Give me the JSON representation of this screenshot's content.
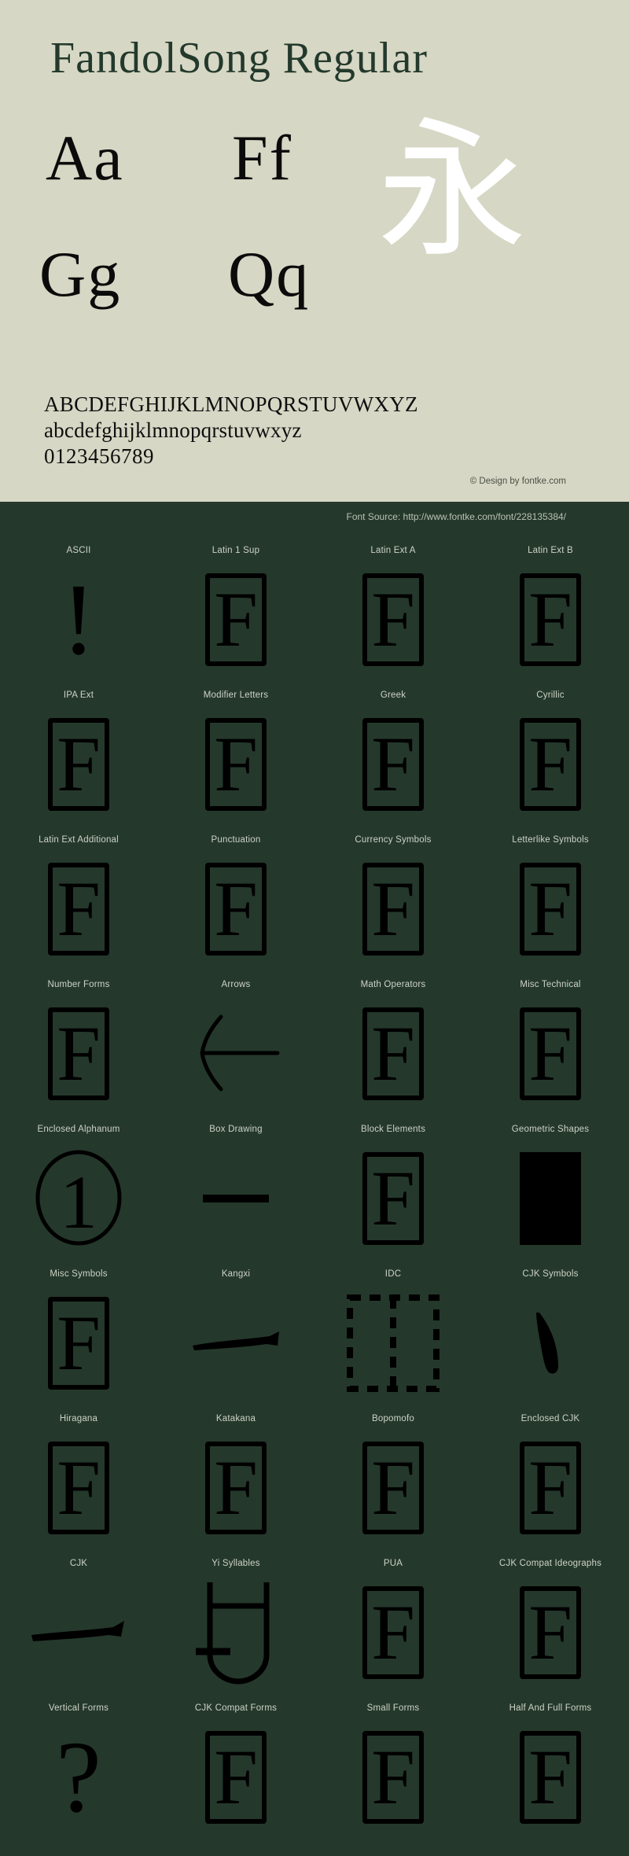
{
  "specimen": {
    "title": "FandolSong Regular",
    "glyph_pairs": [
      "Aa",
      "Ff",
      "Gg",
      "Qq"
    ],
    "cjk_sample": "永",
    "uppercase": "ABCDEFGHIJKLMNOPQRSTUVWXYZ",
    "lowercase": "abcdefghijklmnopqrstuvwxyz",
    "digits": "0123456789",
    "credit": "© Design by fontke.com",
    "bg_color": "#d6d7c4",
    "title_color": "#23392c",
    "cjk_color": "#ffffff"
  },
  "coverage": {
    "source": "Font Source: http://www.fontke.com/font/228135384/",
    "bg_color": "#25382c",
    "label_color": "#ccd3c6",
    "glyph_color": "#000000",
    "blocks": [
      {
        "label": "ASCII",
        "glyph": "!",
        "kind": "exclam"
      },
      {
        "label": "Latin 1 Sup",
        "glyph": "F",
        "kind": "tofu"
      },
      {
        "label": "Latin Ext A",
        "glyph": "F",
        "kind": "tofu"
      },
      {
        "label": "Latin Ext B",
        "glyph": "F",
        "kind": "tofu"
      },
      {
        "label": "IPA Ext",
        "glyph": "F",
        "kind": "tofu"
      },
      {
        "label": "Modifier Letters",
        "glyph": "F",
        "kind": "tofu"
      },
      {
        "label": "Greek",
        "glyph": "F",
        "kind": "tofu"
      },
      {
        "label": "Cyrillic",
        "glyph": "F",
        "kind": "tofu"
      },
      {
        "label": "Latin Ext Additional",
        "glyph": "F",
        "kind": "tofu"
      },
      {
        "label": "Punctuation",
        "glyph": "F",
        "kind": "tofu"
      },
      {
        "label": "Currency Symbols",
        "glyph": "F",
        "kind": "tofu"
      },
      {
        "label": "Letterlike Symbols",
        "glyph": "F",
        "kind": "tofu"
      },
      {
        "label": "Number Forms",
        "glyph": "F",
        "kind": "tofu"
      },
      {
        "label": "Arrows",
        "glyph": "←",
        "kind": "arrow-left"
      },
      {
        "label": "Math Operators",
        "glyph": "F",
        "kind": "tofu"
      },
      {
        "label": "Misc Technical",
        "glyph": "F",
        "kind": "tofu"
      },
      {
        "label": "Enclosed Alphanum",
        "glyph": "①",
        "kind": "circled-one"
      },
      {
        "label": "Box Drawing",
        "glyph": "─",
        "kind": "dash"
      },
      {
        "label": "Block Elements",
        "glyph": "F",
        "kind": "tofu"
      },
      {
        "label": "Geometric Shapes",
        "glyph": "■",
        "kind": "filled-block"
      },
      {
        "label": "Misc Symbols",
        "glyph": "F",
        "kind": "tofu"
      },
      {
        "label": "Kangxi",
        "glyph": "一",
        "kind": "stroke-right"
      },
      {
        "label": "IDC",
        "glyph": "⿰",
        "kind": "idc-dashed"
      },
      {
        "label": "CJK Symbols",
        "glyph": "、",
        "kind": "comma-stroke"
      },
      {
        "label": "Hiragana",
        "glyph": "F",
        "kind": "tofu"
      },
      {
        "label": "Katakana",
        "glyph": "F",
        "kind": "tofu"
      },
      {
        "label": "Bopomofo",
        "glyph": "F",
        "kind": "tofu"
      },
      {
        "label": "Enclosed CJK",
        "glyph": "F",
        "kind": "tofu"
      },
      {
        "label": "CJK",
        "glyph": "一",
        "kind": "stroke-right2"
      },
      {
        "label": "Yi Syllables",
        "glyph": "ꀀ",
        "kind": "yi-shape"
      },
      {
        "label": "PUA",
        "glyph": "F",
        "kind": "tofu"
      },
      {
        "label": "CJK Compat Ideographs",
        "glyph": "F",
        "kind": "tofu"
      },
      {
        "label": "Vertical Forms",
        "glyph": "?",
        "kind": "question"
      },
      {
        "label": "CJK Compat Forms",
        "glyph": "F",
        "kind": "tofu"
      },
      {
        "label": "Small Forms",
        "glyph": "F",
        "kind": "tofu"
      },
      {
        "label": "Half And Full Forms",
        "glyph": "F",
        "kind": "tofu"
      }
    ]
  }
}
